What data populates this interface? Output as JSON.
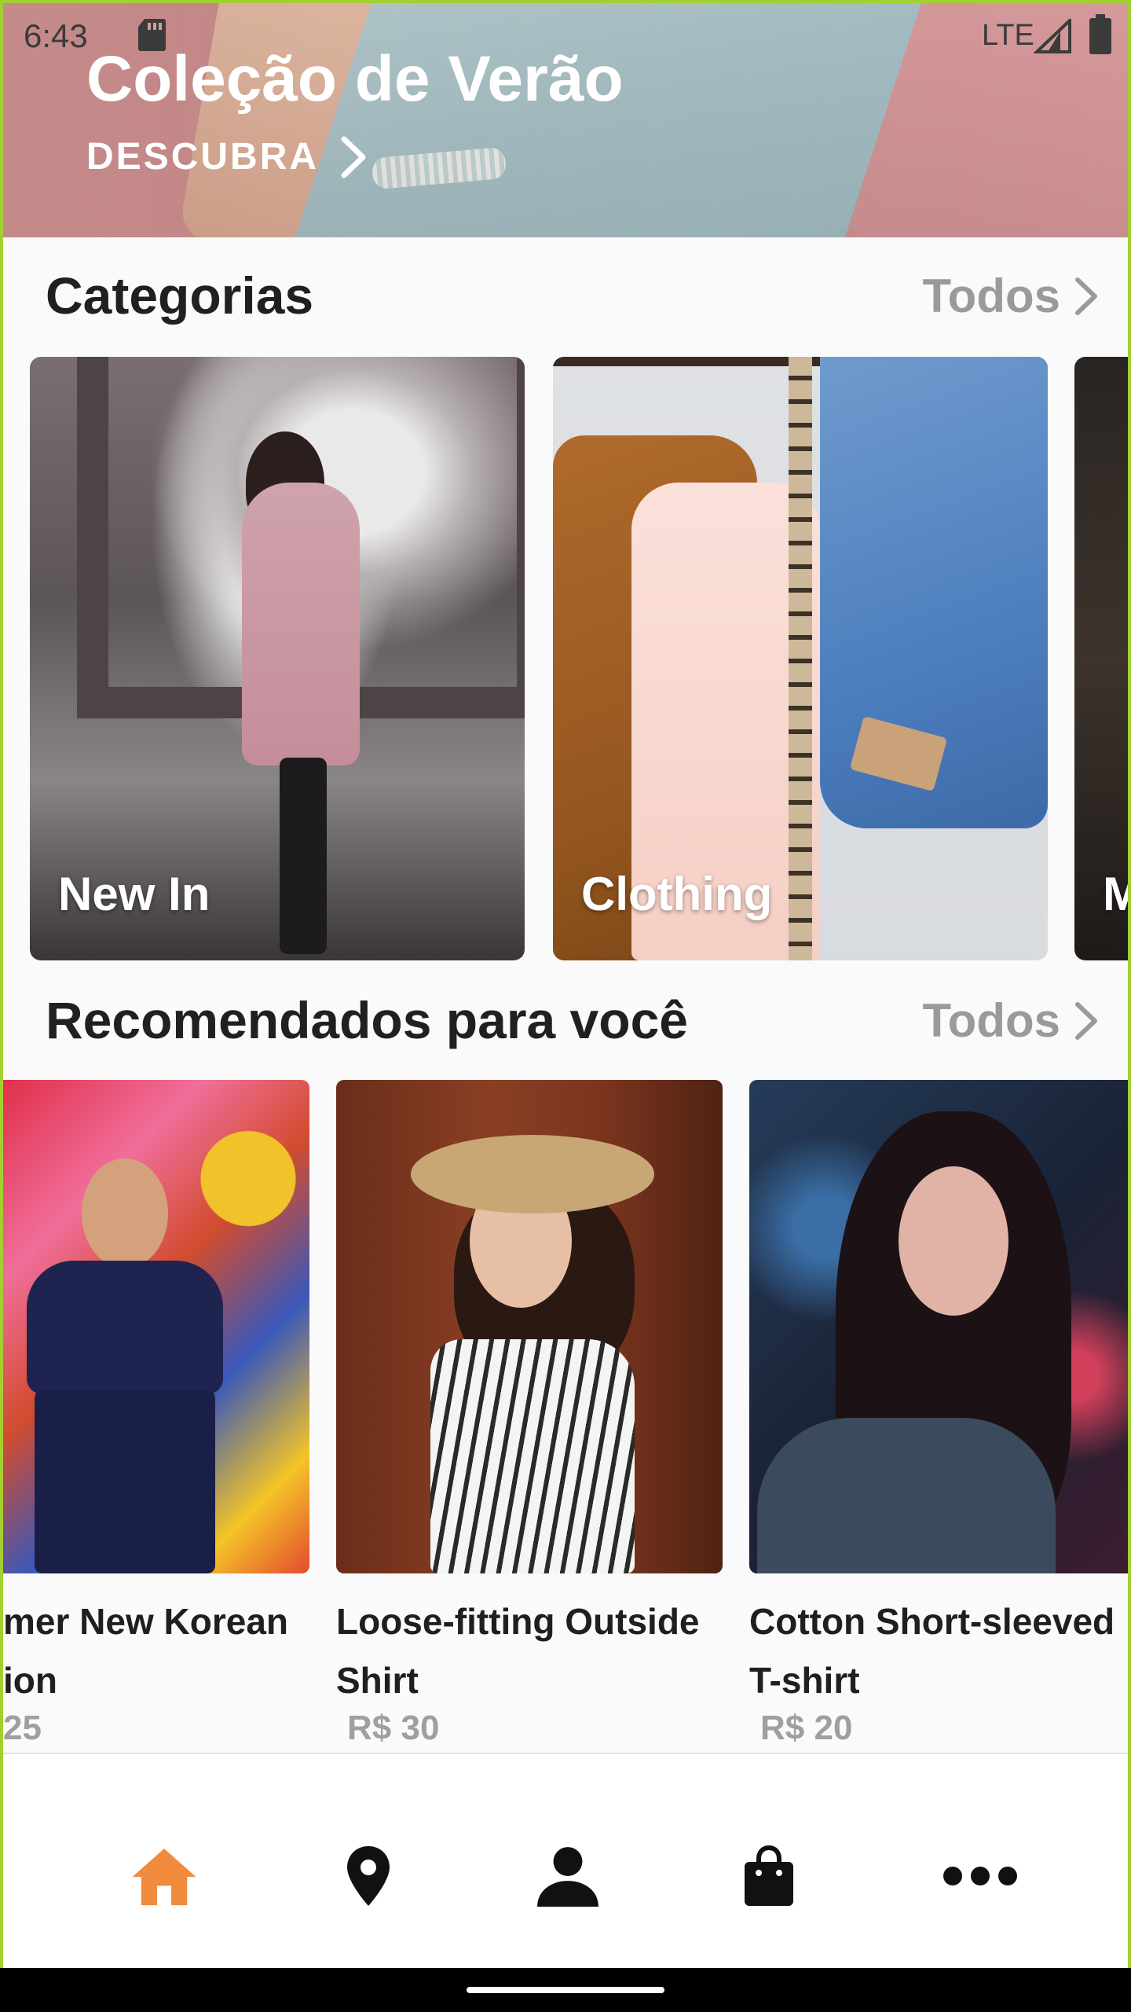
{
  "status_bar": {
    "time": "6:43",
    "network": "LTE",
    "icons": [
      "sd-card-icon",
      "signal-icon",
      "battery-icon"
    ]
  },
  "hero": {
    "title": "Coleção de Verão",
    "cta_label": "DESCUBRA"
  },
  "categories": {
    "title": "Categorias",
    "link_label": "Todos",
    "items": [
      {
        "label": "New In"
      },
      {
        "label": "Clothing"
      },
      {
        "label": "M"
      }
    ]
  },
  "recommended": {
    "title": "Recomendados para você",
    "link_label": "Todos",
    "products": [
      {
        "name": "mer New Korean ion",
        "price": "25"
      },
      {
        "name": "Loose-fitting Outside Shirt",
        "price": "R$ 30"
      },
      {
        "name": "Cotton Short-sleeved T-shirt",
        "price": "R$ 20"
      }
    ]
  },
  "bottom_nav": {
    "items": [
      "home-icon",
      "location-icon",
      "profile-icon",
      "shopping-bag-icon",
      "more-icon"
    ],
    "active_index": 0,
    "active_color": "#f08a3c",
    "inactive_color": "#111111"
  }
}
